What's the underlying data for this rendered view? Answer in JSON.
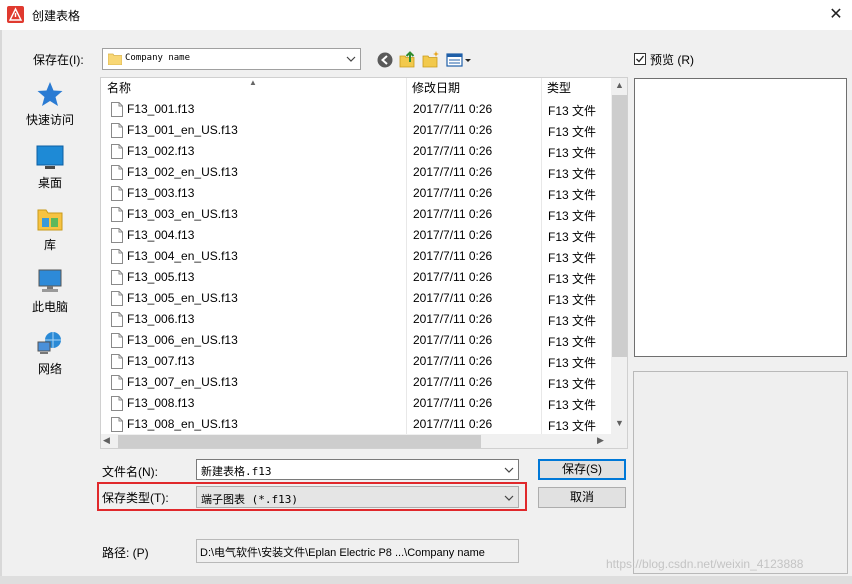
{
  "window": {
    "title": "创建表格",
    "close_glyph": "✕"
  },
  "toolbar": {
    "save_in_label": "保存在(I):",
    "save_in_value": "Company name",
    "icons": [
      "back-icon",
      "up-folder-icon",
      "new-folder-icon",
      "views-menu-icon"
    ]
  },
  "preview": {
    "label": "预览 (R)",
    "checked": true
  },
  "places": [
    {
      "label": "快速访问",
      "icon": "quick-access-star-icon"
    },
    {
      "label": "桌面",
      "icon": "desktop-icon"
    },
    {
      "label": "库",
      "icon": "library-icon"
    },
    {
      "label": "此电脑",
      "icon": "computer-icon"
    },
    {
      "label": "网络",
      "icon": "network-icon"
    }
  ],
  "columns": {
    "name": "名称",
    "date": "修改日期",
    "type": "类型"
  },
  "files": [
    {
      "name": "F13_001.f13",
      "date": "2017/7/11 0:26",
      "type": "F13 文件"
    },
    {
      "name": "F13_001_en_US.f13",
      "date": "2017/7/11 0:26",
      "type": "F13 文件"
    },
    {
      "name": "F13_002.f13",
      "date": "2017/7/11 0:26",
      "type": "F13 文件"
    },
    {
      "name": "F13_002_en_US.f13",
      "date": "2017/7/11 0:26",
      "type": "F13 文件"
    },
    {
      "name": "F13_003.f13",
      "date": "2017/7/11 0:26",
      "type": "F13 文件"
    },
    {
      "name": "F13_003_en_US.f13",
      "date": "2017/7/11 0:26",
      "type": "F13 文件"
    },
    {
      "name": "F13_004.f13",
      "date": "2017/7/11 0:26",
      "type": "F13 文件"
    },
    {
      "name": "F13_004_en_US.f13",
      "date": "2017/7/11 0:26",
      "type": "F13 文件"
    },
    {
      "name": "F13_005.f13",
      "date": "2017/7/11 0:26",
      "type": "F13 文件"
    },
    {
      "name": "F13_005_en_US.f13",
      "date": "2017/7/11 0:26",
      "type": "F13 文件"
    },
    {
      "name": "F13_006.f13",
      "date": "2017/7/11 0:26",
      "type": "F13 文件"
    },
    {
      "name": "F13_006_en_US.f13",
      "date": "2017/7/11 0:26",
      "type": "F13 文件"
    },
    {
      "name": "F13_007.f13",
      "date": "2017/7/11 0:26",
      "type": "F13 文件"
    },
    {
      "name": "F13_007_en_US.f13",
      "date": "2017/7/11 0:26",
      "type": "F13 文件"
    },
    {
      "name": "F13_008.f13",
      "date": "2017/7/11 0:26",
      "type": "F13 文件"
    },
    {
      "name": "F13_008_en_US.f13",
      "date": "2017/7/11 0:26",
      "type": "F13 文件"
    }
  ],
  "form": {
    "filename_label": "文件名(N):",
    "filename_value": "新建表格.f13",
    "savetype_label": "保存类型(T):",
    "savetype_value": "端子图表 (*.f13)",
    "path_label": "路径: (P)",
    "path_value": "D:\\电气软件\\安装文件\\Eplan Electric P8 ...\\Company name"
  },
  "buttons": {
    "save": "保存(S)",
    "cancel": "取消"
  },
  "watermark": "https://blog.csdn.net/weixin_4123888",
  "colors": {
    "highlight_border": "#e0282b",
    "default_button_border": "#0078d7",
    "app_icon_red": "#e03a2f"
  }
}
